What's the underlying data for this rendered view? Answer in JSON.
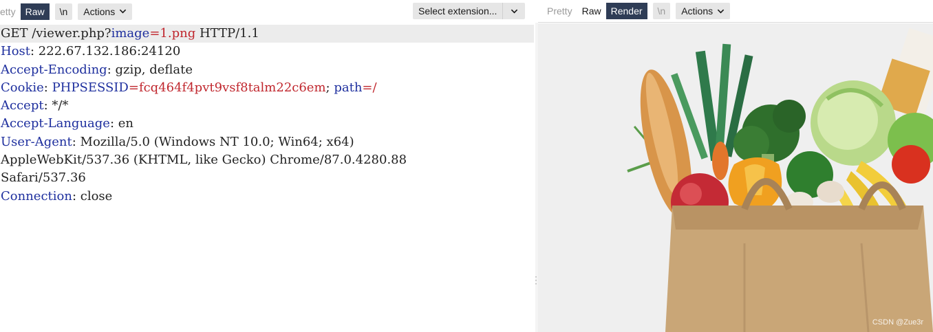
{
  "left_toolbar": {
    "pretty_label": "etty",
    "raw_label": "Raw",
    "newline_label": "\\n",
    "actions_label": "Actions",
    "extension_select": "Select extension..."
  },
  "right_toolbar": {
    "pretty_label": "Pretty",
    "raw_label": "Raw",
    "render_label": "Render",
    "newline_label": "\\n",
    "actions_label": "Actions"
  },
  "request": {
    "line1": {
      "pre": "GET /viewer.php?",
      "key": "image",
      "eq": "=",
      "val": "1.png",
      "post": " HTTP/1.1"
    },
    "host": {
      "key": "Host",
      "val": ": 222.67.132.186:24120"
    },
    "accept_encoding": {
      "key": "Accept-Encoding",
      "val": ": gzip, deflate"
    },
    "cookie": {
      "key": "Cookie",
      "sep": ": ",
      "name1": "PHPSESSID",
      "eq1": "=",
      "val1": "fcq464f4pvt9vsf8talm22c6em",
      "semi": "; ",
      "name2": "path",
      "eq2": "=",
      "val2": "/"
    },
    "accept": {
      "key": "Accept",
      "val": ": */*"
    },
    "accept_language": {
      "key": "Accept-Language",
      "val": ": en"
    },
    "user_agent": {
      "key": "User-Agent",
      "val": ": Mozilla/5.0 (Windows NT 10.0; Win64; x64)"
    },
    "user_agent_cont1": "AppleWebKit/537.36 (KHTML, like Gecko) Chrome/87.0.4280.88",
    "user_agent_cont2": "Safari/537.36",
    "connection": {
      "key": "Connection",
      "val": ": close"
    }
  },
  "render_view": {
    "image_subject": "grocery bag with vegetables and bread",
    "watermark": "CSDN @Zue3r"
  },
  "colors": {
    "active_tab": "#2f3d56",
    "header_key": "#1e2f9e",
    "header_value": "#c0262d",
    "highlight_line": "#ececec"
  },
  "icons": [
    "chevron-down-icon",
    "splitter-handle-icon"
  ]
}
